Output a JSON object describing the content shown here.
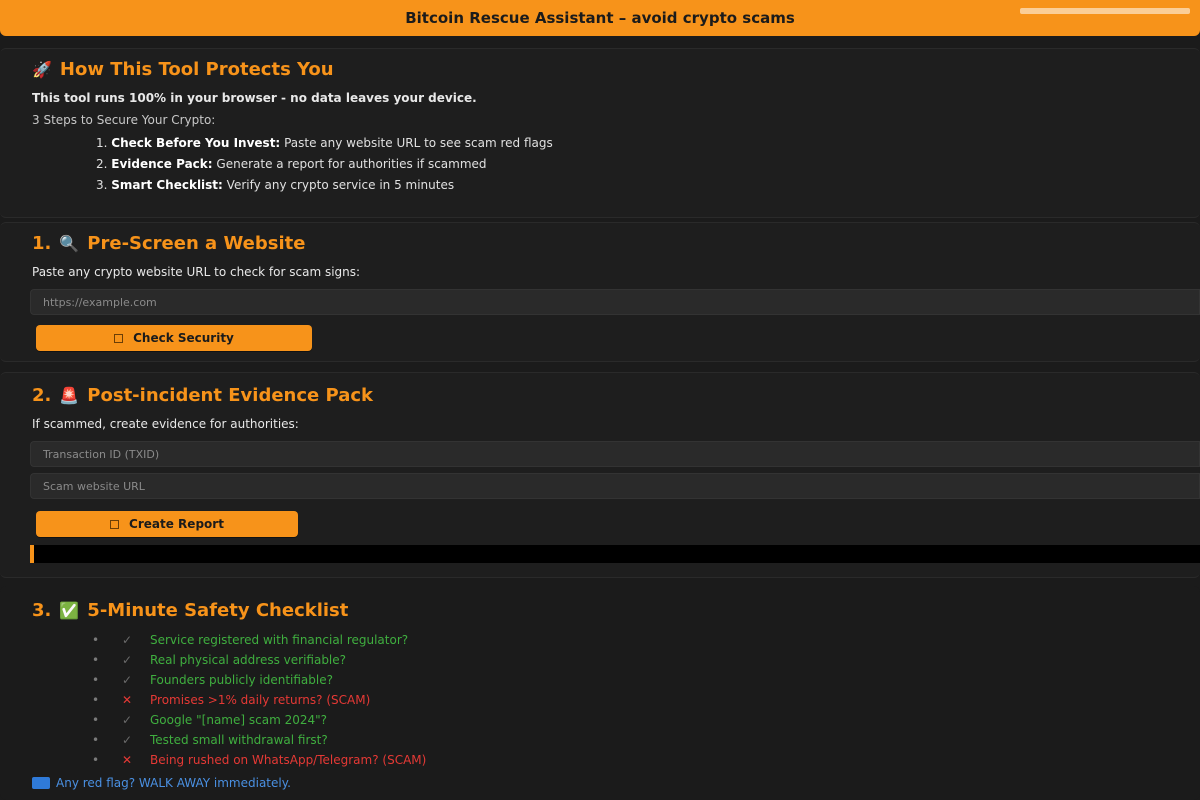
{
  "banner": {
    "title": "Bitcoin Rescue Assistant – avoid crypto scams"
  },
  "info": {
    "emoji": "🚀",
    "heading": "How This Tool Protects You",
    "privacy": "This tool runs 100% in your browser - no data leaves your device.",
    "steps_intro": "3 Steps to Secure Your Crypto:",
    "steps": [
      {
        "num": "1.",
        "title": "Check Before You Invest:",
        "desc": "Paste any website URL to see scam red flags"
      },
      {
        "num": "2.",
        "title": "Evidence Pack:",
        "desc": "Generate a report for authorities if scammed"
      },
      {
        "num": "3.",
        "title": "Smart Checklist:",
        "desc": "Verify any crypto service in 5 minutes"
      }
    ]
  },
  "prescreen": {
    "num": "1.",
    "emoji": "🔍",
    "heading": "Pre-Screen a Website",
    "instruction": "Paste any crypto website URL to check for scam signs:",
    "url_placeholder": "https://example.com",
    "button_label": "Check Security"
  },
  "evidence": {
    "num": "2.",
    "emoji": "🚨",
    "heading": "Post-incident Evidence Pack",
    "instruction": "If scammed, create evidence for authorities:",
    "txid_placeholder": "Transaction ID (TXID)",
    "scam_url_placeholder": "Scam website URL",
    "button_label": "Create Report"
  },
  "checklist": {
    "num": "3.",
    "emoji": "✅",
    "heading": "5-Minute Safety Checklist",
    "items": [
      {
        "mark": "✓",
        "status": "ok",
        "text": "Service registered with financial regulator?"
      },
      {
        "mark": "✓",
        "status": "ok",
        "text": "Real physical address verifiable?"
      },
      {
        "mark": "✓",
        "status": "ok",
        "text": "Founders publicly identifiable?"
      },
      {
        "mark": "✕",
        "status": "bad",
        "text": "Promises >1% daily returns? (SCAM)"
      },
      {
        "mark": "✓",
        "status": "ok",
        "text": "Google \"[name] scam 2024\"?"
      },
      {
        "mark": "✓",
        "status": "ok",
        "text": "Tested small withdrawal first?"
      },
      {
        "mark": "✕",
        "status": "bad",
        "text": "Being rushed on WhatsApp/Telegram? (SCAM)"
      }
    ],
    "footer": "Any red flag? WALK AWAY immediately."
  },
  "colors": {
    "accent": "#f7931a",
    "ok": "#3fae3f",
    "bad": "#e53935",
    "link": "#4a90e2"
  }
}
